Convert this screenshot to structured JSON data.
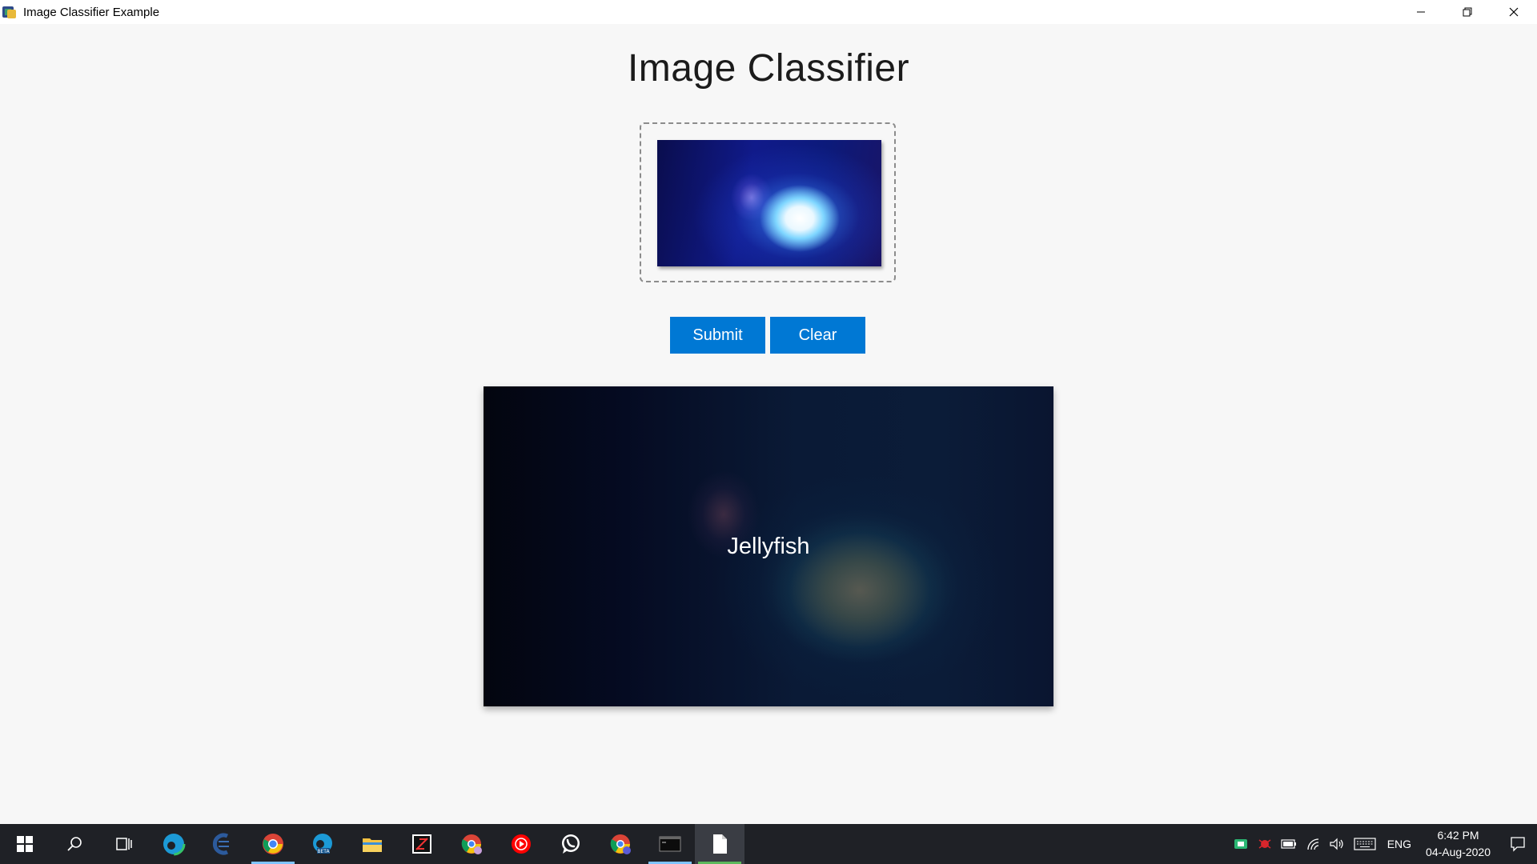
{
  "window": {
    "title": "Image Classifier Example",
    "controls": [
      "minimize",
      "restore",
      "close"
    ]
  },
  "main": {
    "heading": "Image Classifier",
    "submit_label": "Submit",
    "clear_label": "Clear",
    "prediction": "Jellyfish"
  },
  "taskbar": {
    "apps": [
      {
        "icon": "windows-start-icon"
      },
      {
        "icon": "search-icon"
      },
      {
        "icon": "task-view-icon"
      },
      {
        "icon": "edge-icon"
      },
      {
        "icon": "eclipse-icon"
      },
      {
        "icon": "chrome-icon"
      },
      {
        "icon": "edge-beta-icon"
      },
      {
        "icon": "file-explorer-icon"
      },
      {
        "icon": "app-icon"
      },
      {
        "icon": "chrome-profile-icon"
      },
      {
        "icon": "youtube-music-icon"
      },
      {
        "icon": "whatsapp-icon"
      },
      {
        "icon": "chrome-profile-2-icon"
      },
      {
        "icon": "terminal-icon"
      },
      {
        "icon": "document-icon"
      }
    ],
    "tray": {
      "language": "ENG",
      "time": "6:42 PM",
      "date": "04-Aug-2020"
    }
  },
  "colors": {
    "accent": "#0078d4",
    "background": "#f7f7f7",
    "taskbar": "#1f2126"
  }
}
